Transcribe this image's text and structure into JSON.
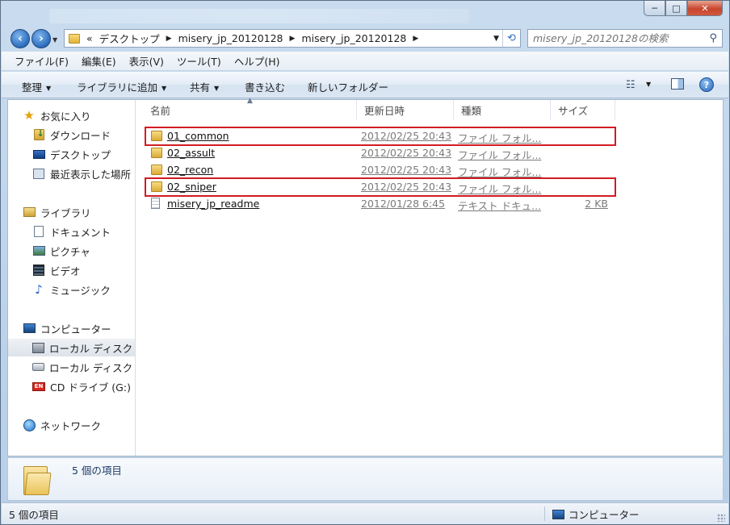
{
  "window": {
    "controls": {
      "minimize": "─",
      "maximize": "□",
      "close": "✕"
    }
  },
  "address": {
    "overflow": "«",
    "crumbs": [
      "デスクトップ",
      "misery_jp_20120128",
      "misery_jp_20120128"
    ]
  },
  "search": {
    "placeholder": "misery_jp_20120128の検索"
  },
  "menubar": {
    "items": [
      "ファイル(F)",
      "編集(E)",
      "表示(V)",
      "ツール(T)",
      "ヘルプ(H)"
    ]
  },
  "toolbar": {
    "organize": "整理",
    "add_to_library": "ライブラリに追加",
    "share": "共有",
    "burn": "書き込む",
    "new_folder": "新しいフォルダー"
  },
  "navpane": {
    "favorites": "お気に入り",
    "downloads": "ダウンロード",
    "desktop": "デスクトップ",
    "recent": "最近表示した場所",
    "libraries": "ライブラリ",
    "documents": "ドキュメント",
    "pictures": "ピクチャ",
    "videos": "ビデオ",
    "music": "ミュージック",
    "computer": "コンピューター",
    "local_disk_1": "ローカル ディスク (",
    "local_disk_2": "ローカル ディスク (",
    "cd_drive": "CD ドライブ (G:) E",
    "network": "ネットワーク"
  },
  "columns": {
    "name": "名前",
    "date": "更新日時",
    "type": "種類",
    "size": "サイズ"
  },
  "files": [
    {
      "name": "01_common",
      "date": "2012/02/25 20:43",
      "type": "ファイル フォル...",
      "size": "",
      "icon": "folder-icon",
      "highlighted": true
    },
    {
      "name": "02_assult",
      "date": "2012/02/25 20:43",
      "type": "ファイル フォル...",
      "size": "",
      "icon": "folder-icon",
      "highlighted": false
    },
    {
      "name": "02_recon",
      "date": "2012/02/25 20:43",
      "type": "ファイル フォル...",
      "size": "",
      "icon": "folder-icon",
      "highlighted": false
    },
    {
      "name": "02_sniper",
      "date": "2012/02/25 20:43",
      "type": "ファイル フォル...",
      "size": "",
      "icon": "folder-icon",
      "highlighted": true
    },
    {
      "name": "misery_jp_readme",
      "date": "2012/01/28 6:45",
      "type": "テキスト ドキュ...",
      "size": "2 KB",
      "icon": "text-file-icon",
      "highlighted": false
    }
  ],
  "details": {
    "item_count": "5 個の項目"
  },
  "statusbar": {
    "left": "5 個の項目",
    "right": "コンピューター"
  },
  "colors": {
    "highlight": "#d21c22",
    "selection": "#dde3ea"
  }
}
